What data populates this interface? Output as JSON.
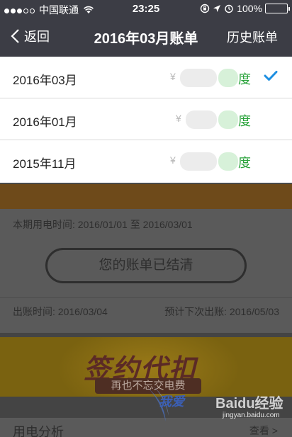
{
  "status": {
    "carrier": "中国联通",
    "time": "23:25",
    "battery": "100%",
    "signal_bars": 3
  },
  "nav": {
    "back_label": "返回",
    "title": "2016年03月账单",
    "history_label": "历史账单"
  },
  "dropdown": {
    "items": [
      {
        "date": "2016年03月",
        "currency": "¥",
        "unit": "度",
        "selected": true
      },
      {
        "date": "2016年01月",
        "currency": "¥",
        "unit": "度",
        "selected": false
      },
      {
        "date": "2015年11月",
        "currency": "¥",
        "unit": "度",
        "selected": false
      }
    ]
  },
  "bill": {
    "period": "本期用电时间: 2016/01/01 至 2016/03/01",
    "settled_label": "您的账单已结清",
    "issue_date": "出账时间: 2016/03/04",
    "next_date": "预计下次出账: 2016/05/03"
  },
  "banner": {
    "headline": "签约代扣",
    "subline": "再也不忘交电费"
  },
  "analysis": {
    "label": "用电分析",
    "more": "查看 >"
  },
  "watermark": {
    "text1": "我爱",
    "text2": "Baidu经验",
    "url": "jingyan.baidu.com"
  },
  "colors": {
    "nav_bg": "#3c3d45",
    "accent_blue": "#1e8fe1",
    "unit_green": "#2aa33b",
    "battery_green": "#4cd964"
  }
}
